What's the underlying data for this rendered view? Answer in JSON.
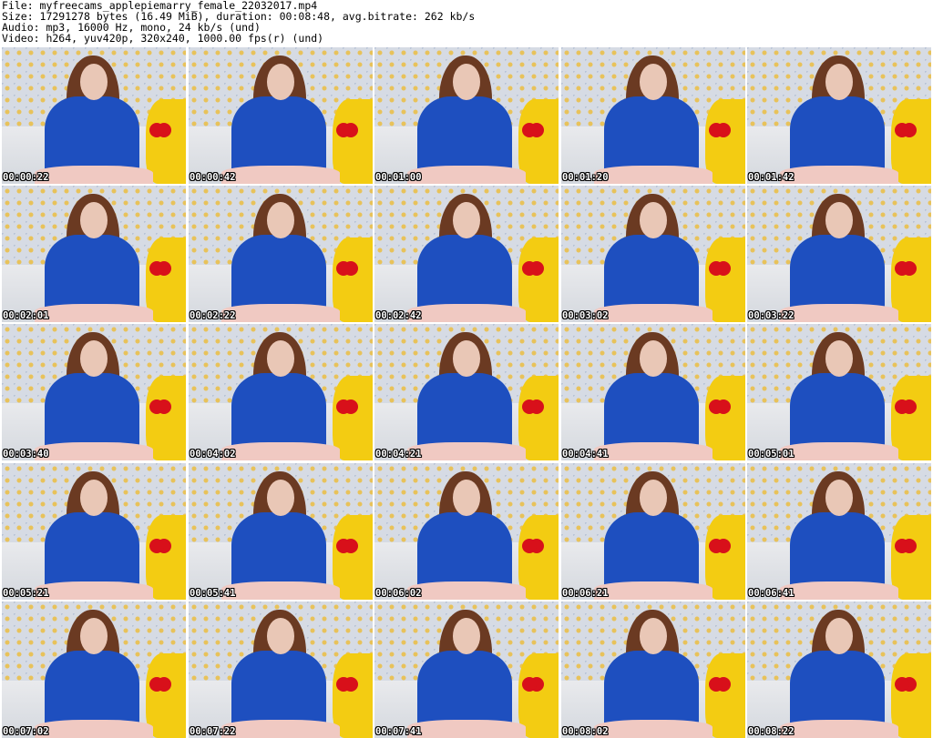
{
  "header": {
    "file": "File: myfreecams_applepiemarry_female_22032017.mp4",
    "size": "Size: 17291278 bytes (16.49 MiB), duration: 00:08:48, avg.bitrate: 262 kb/s",
    "audio": "Audio: mp3, 16000 Hz, mono, 24 kb/s (und)",
    "video": "Video: h264, yuv420p, 320x240, 1000.00 fps(r) (und)"
  },
  "thumbnails": [
    {
      "time": "00:00:22"
    },
    {
      "time": "00:00:42"
    },
    {
      "time": "00:01:00"
    },
    {
      "time": "00:01:20"
    },
    {
      "time": "00:01:42"
    },
    {
      "time": "00:02:01"
    },
    {
      "time": "00:02:22"
    },
    {
      "time": "00:02:42"
    },
    {
      "time": "00:03:02"
    },
    {
      "time": "00:03:22"
    },
    {
      "time": "00:03:40"
    },
    {
      "time": "00:04:02"
    },
    {
      "time": "00:04:21"
    },
    {
      "time": "00:04:41"
    },
    {
      "time": "00:05:01"
    },
    {
      "time": "00:05:21"
    },
    {
      "time": "00:05:41"
    },
    {
      "time": "00:06:02"
    },
    {
      "time": "00:06:21"
    },
    {
      "time": "00:06:41"
    },
    {
      "time": "00:07:02"
    },
    {
      "time": "00:07:22"
    },
    {
      "time": "00:07:41"
    },
    {
      "time": "00:08:02"
    },
    {
      "time": "00:08:22"
    }
  ]
}
